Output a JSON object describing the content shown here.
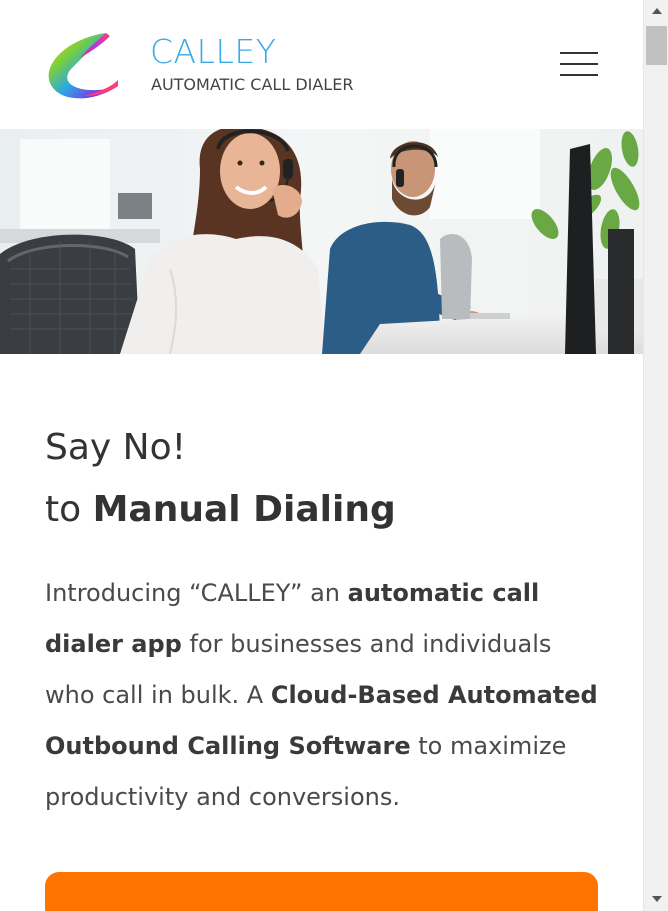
{
  "header": {
    "logo_title": "CALLEY",
    "logo_subtitle": "AUTOMATIC CALL DIALER",
    "menu_icon": "hamburger-menu-icon"
  },
  "hero": {
    "image": "call-center-agents-photo"
  },
  "headline": {
    "line1": "Say No!",
    "line2_prefix": "to ",
    "line2_bold": "Manual Dialing"
  },
  "intro": {
    "t1": "Introducing “CALLEY” an ",
    "b1": "automatic call dialer app",
    "t2": " for businesses and individuals who call in bulk. A ",
    "b2": "Cloud-Based Automated Outbound Calling Software",
    "t3": " to maximize productivity and conversions."
  },
  "colors": {
    "brand_blue": "#3aa9e8",
    "cta_orange": "#ff7300",
    "text_dark": "#333333"
  },
  "scrollbar": {
    "up_icon": "scroll-up-arrow-icon",
    "down_icon": "scroll-down-arrow-icon"
  }
}
